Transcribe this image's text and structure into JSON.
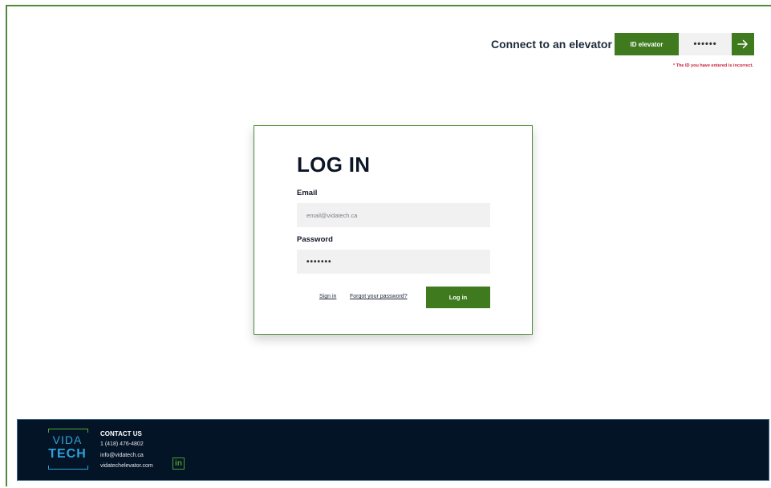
{
  "elevator_connect": {
    "title": "Connect to an elevator",
    "id_label": "ID elevator",
    "password_value": "••••••",
    "go_icon": "arrow-right-icon",
    "error_message": "* The ID you have entered is incorrect."
  },
  "login": {
    "title": "LOG IN",
    "email_label": "Email",
    "email_placeholder": "email@vidatech.ca",
    "password_label": "Password",
    "password_value": "•••••••",
    "signin_link": "Sign in",
    "forgot_link": "Forgot your password?",
    "login_button": "Log in"
  },
  "footer": {
    "logo_top": "VIDA",
    "logo_bottom": "TECH",
    "contact_title": "CONTACT US",
    "phone": "1 (418) 476-4802",
    "email": "info@vidatech.ca",
    "website": "vidatechelevator.com",
    "linkedin_label": "in",
    "linkedin_icon": "linkedin-icon"
  },
  "colors": {
    "brand_green": "#3f7a1f",
    "footer_navy": "#041427",
    "logo_blue": "#2ea1d8",
    "error_red": "#c8203a"
  }
}
